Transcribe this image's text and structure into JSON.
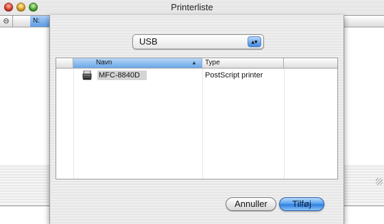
{
  "window": {
    "title": "Printerliste",
    "bg_sort_glyph": "⊖",
    "bg_column_label": "N:"
  },
  "sheet": {
    "connection_popup": {
      "selected": "USB",
      "arrows": "▴▾"
    },
    "list": {
      "columns": {
        "name": "Navn",
        "type": "Type",
        "sort_indicator": "▲"
      },
      "rows": [
        {
          "name": "MFC-8840D",
          "type": "PostScript printer",
          "icon": "printer-icon"
        }
      ]
    },
    "buttons": {
      "cancel": "Annuller",
      "add": "Tilføj"
    }
  },
  "colors": {
    "accent_blue": "#3f87e0",
    "selected_header": "#6aa7ea"
  }
}
